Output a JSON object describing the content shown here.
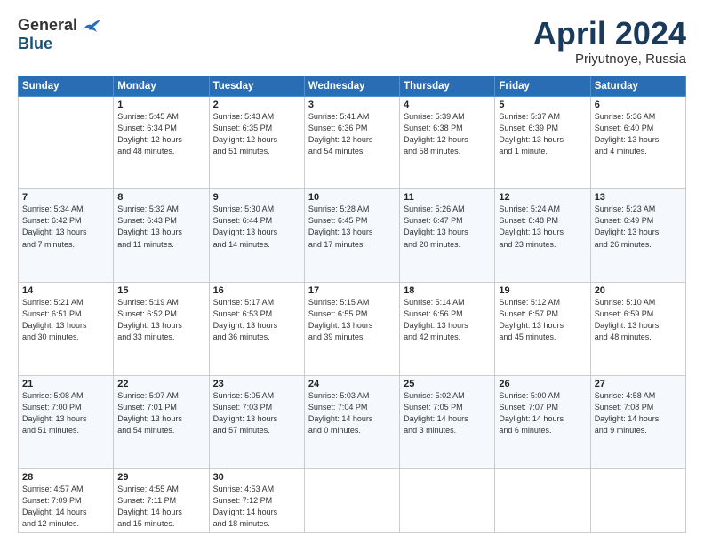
{
  "header": {
    "logo_general": "General",
    "logo_blue": "Blue",
    "month_title": "April 2024",
    "subtitle": "Priyutnoye, Russia"
  },
  "days_of_week": [
    "Sunday",
    "Monday",
    "Tuesday",
    "Wednesday",
    "Thursday",
    "Friday",
    "Saturday"
  ],
  "weeks": [
    [
      {
        "day": "",
        "info": ""
      },
      {
        "day": "1",
        "info": "Sunrise: 5:45 AM\nSunset: 6:34 PM\nDaylight: 12 hours\nand 48 minutes."
      },
      {
        "day": "2",
        "info": "Sunrise: 5:43 AM\nSunset: 6:35 PM\nDaylight: 12 hours\nand 51 minutes."
      },
      {
        "day": "3",
        "info": "Sunrise: 5:41 AM\nSunset: 6:36 PM\nDaylight: 12 hours\nand 54 minutes."
      },
      {
        "day": "4",
        "info": "Sunrise: 5:39 AM\nSunset: 6:38 PM\nDaylight: 12 hours\nand 58 minutes."
      },
      {
        "day": "5",
        "info": "Sunrise: 5:37 AM\nSunset: 6:39 PM\nDaylight: 13 hours\nand 1 minute."
      },
      {
        "day": "6",
        "info": "Sunrise: 5:36 AM\nSunset: 6:40 PM\nDaylight: 13 hours\nand 4 minutes."
      }
    ],
    [
      {
        "day": "7",
        "info": "Sunrise: 5:34 AM\nSunset: 6:42 PM\nDaylight: 13 hours\nand 7 minutes."
      },
      {
        "day": "8",
        "info": "Sunrise: 5:32 AM\nSunset: 6:43 PM\nDaylight: 13 hours\nand 11 minutes."
      },
      {
        "day": "9",
        "info": "Sunrise: 5:30 AM\nSunset: 6:44 PM\nDaylight: 13 hours\nand 14 minutes."
      },
      {
        "day": "10",
        "info": "Sunrise: 5:28 AM\nSunset: 6:45 PM\nDaylight: 13 hours\nand 17 minutes."
      },
      {
        "day": "11",
        "info": "Sunrise: 5:26 AM\nSunset: 6:47 PM\nDaylight: 13 hours\nand 20 minutes."
      },
      {
        "day": "12",
        "info": "Sunrise: 5:24 AM\nSunset: 6:48 PM\nDaylight: 13 hours\nand 23 minutes."
      },
      {
        "day": "13",
        "info": "Sunrise: 5:23 AM\nSunset: 6:49 PM\nDaylight: 13 hours\nand 26 minutes."
      }
    ],
    [
      {
        "day": "14",
        "info": "Sunrise: 5:21 AM\nSunset: 6:51 PM\nDaylight: 13 hours\nand 30 minutes."
      },
      {
        "day": "15",
        "info": "Sunrise: 5:19 AM\nSunset: 6:52 PM\nDaylight: 13 hours\nand 33 minutes."
      },
      {
        "day": "16",
        "info": "Sunrise: 5:17 AM\nSunset: 6:53 PM\nDaylight: 13 hours\nand 36 minutes."
      },
      {
        "day": "17",
        "info": "Sunrise: 5:15 AM\nSunset: 6:55 PM\nDaylight: 13 hours\nand 39 minutes."
      },
      {
        "day": "18",
        "info": "Sunrise: 5:14 AM\nSunset: 6:56 PM\nDaylight: 13 hours\nand 42 minutes."
      },
      {
        "day": "19",
        "info": "Sunrise: 5:12 AM\nSunset: 6:57 PM\nDaylight: 13 hours\nand 45 minutes."
      },
      {
        "day": "20",
        "info": "Sunrise: 5:10 AM\nSunset: 6:59 PM\nDaylight: 13 hours\nand 48 minutes."
      }
    ],
    [
      {
        "day": "21",
        "info": "Sunrise: 5:08 AM\nSunset: 7:00 PM\nDaylight: 13 hours\nand 51 minutes."
      },
      {
        "day": "22",
        "info": "Sunrise: 5:07 AM\nSunset: 7:01 PM\nDaylight: 13 hours\nand 54 minutes."
      },
      {
        "day": "23",
        "info": "Sunrise: 5:05 AM\nSunset: 7:03 PM\nDaylight: 13 hours\nand 57 minutes."
      },
      {
        "day": "24",
        "info": "Sunrise: 5:03 AM\nSunset: 7:04 PM\nDaylight: 14 hours\nand 0 minutes."
      },
      {
        "day": "25",
        "info": "Sunrise: 5:02 AM\nSunset: 7:05 PM\nDaylight: 14 hours\nand 3 minutes."
      },
      {
        "day": "26",
        "info": "Sunrise: 5:00 AM\nSunset: 7:07 PM\nDaylight: 14 hours\nand 6 minutes."
      },
      {
        "day": "27",
        "info": "Sunrise: 4:58 AM\nSunset: 7:08 PM\nDaylight: 14 hours\nand 9 minutes."
      }
    ],
    [
      {
        "day": "28",
        "info": "Sunrise: 4:57 AM\nSunset: 7:09 PM\nDaylight: 14 hours\nand 12 minutes."
      },
      {
        "day": "29",
        "info": "Sunrise: 4:55 AM\nSunset: 7:11 PM\nDaylight: 14 hours\nand 15 minutes."
      },
      {
        "day": "30",
        "info": "Sunrise: 4:53 AM\nSunset: 7:12 PM\nDaylight: 14 hours\nand 18 minutes."
      },
      {
        "day": "",
        "info": ""
      },
      {
        "day": "",
        "info": ""
      },
      {
        "day": "",
        "info": ""
      },
      {
        "day": "",
        "info": ""
      }
    ]
  ]
}
